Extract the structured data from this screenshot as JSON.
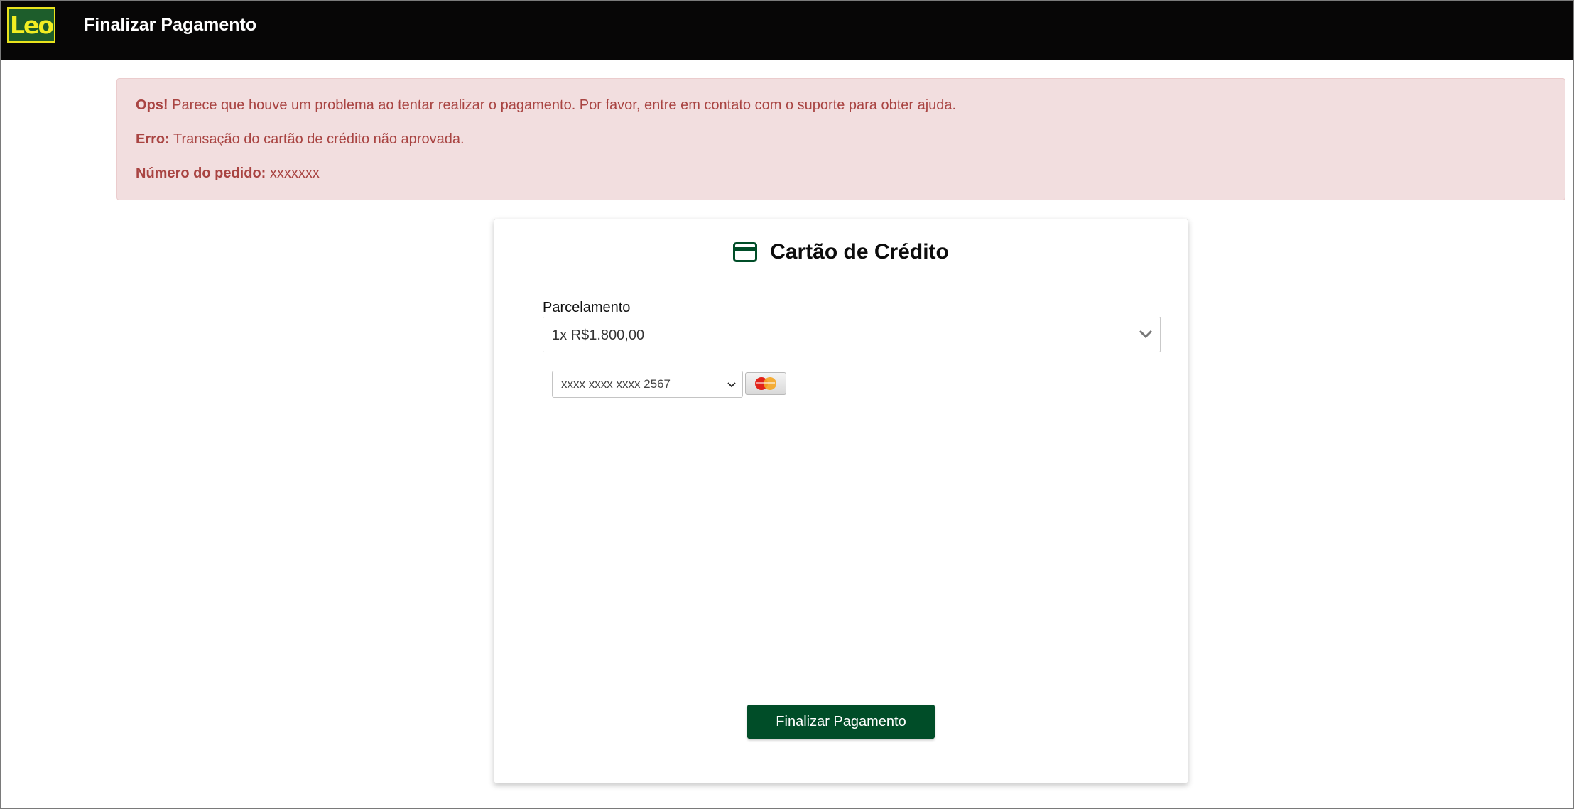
{
  "header": {
    "logo_text": "Leo",
    "title": "Finalizar Pagamento"
  },
  "alert": {
    "ops_label": "Ops!",
    "ops_text": " Parece que houve um problema ao tentar realizar o pagamento. Por favor, entre em contato com o suporte para obter ajuda.",
    "error_label": "Erro:",
    "error_text": " Transação do cartão de crédito não aprovada.",
    "order_label": "Número do pedido:",
    "order_value": " xxxxxxx"
  },
  "card": {
    "title": "Cartão de Crédito",
    "icon": "credit-card-icon",
    "installments_label": "Parcelamento",
    "installments_value": "1x R$1.800,00",
    "saved_card_value": "xxxx xxxx xxxx 2567",
    "card_brand": "mastercard",
    "submit_label": "Finalizar Pagamento"
  },
  "colors": {
    "header_bg": "#070606",
    "brand_green": "#004d28",
    "alert_bg": "#f2dedf",
    "alert_text": "#a94442"
  }
}
